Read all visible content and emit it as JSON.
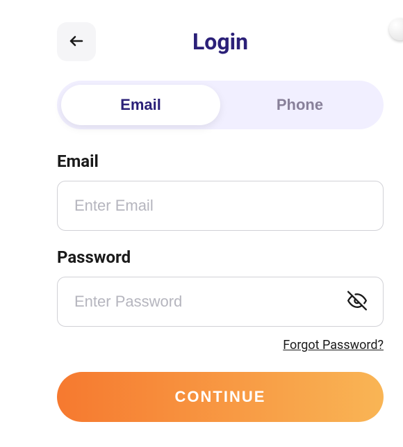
{
  "header": {
    "title": "Login"
  },
  "tabs": {
    "email": "Email",
    "phone": "Phone"
  },
  "form": {
    "email_label": "Email",
    "email_placeholder": "Enter Email",
    "password_label": "Password",
    "password_placeholder": "Enter Password"
  },
  "links": {
    "forgot_password": "Forgot Password?"
  },
  "buttons": {
    "continue": "CONTINUE"
  }
}
